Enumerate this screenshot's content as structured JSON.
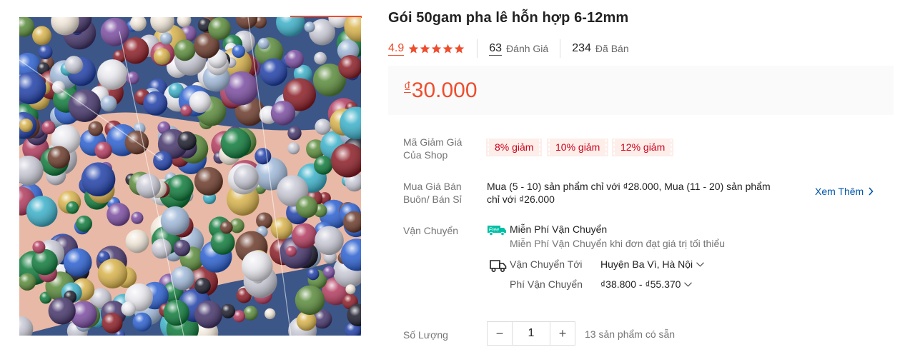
{
  "product": {
    "title": "Gói 50gam pha lê hỗn hợp 6-12mm"
  },
  "rating": {
    "score": "4.9",
    "stars": 5,
    "reviews_count": "63",
    "reviews_label": "Đánh Giá",
    "sold_count": "234",
    "sold_label": "Đã Bán"
  },
  "price": {
    "currency": "₫",
    "amount": "30.000"
  },
  "vouchers": {
    "label_line1": "Mã Giảm Giá",
    "label_line2": "Của Shop",
    "items": [
      "8% giảm",
      "10% giảm",
      "12% giảm"
    ]
  },
  "wholesale": {
    "label_line1": "Mua Giá Bán",
    "label_line2": "Buôn/ Bán Sỉ",
    "text_line1": "Mua (5 - 10) sản phẩm chỉ với ₫28.000, Mua (11 - 20) sản phẩm",
    "text_line2": "chỉ với ₫26.000",
    "see_more": "Xem Thêm"
  },
  "shipping": {
    "label": "Vận Chuyển",
    "free_badge": "Free",
    "free_title": "Miễn Phí Vận Chuyển",
    "free_sub": "Miễn Phí Vận Chuyển khi đơn đạt giá trị tối thiểu",
    "to_label": "Vận Chuyển Tới",
    "to_value": "Huyện Ba Vì, Hà Nội",
    "fee_label": "Phí Vận Chuyển",
    "fee_value": "₫38.800 - ₫55.370"
  },
  "quantity": {
    "label": "Số Lượng",
    "minus": "−",
    "value": "1",
    "plus": "+",
    "stock": "13 sản phẩm có sẵn"
  },
  "colors": {
    "accent": "#ee4d2d",
    "voucher_bg": "#fdeeea",
    "voucher_text": "#d0011b",
    "link": "#0055aa",
    "free_ship": "#00bfa5"
  }
}
